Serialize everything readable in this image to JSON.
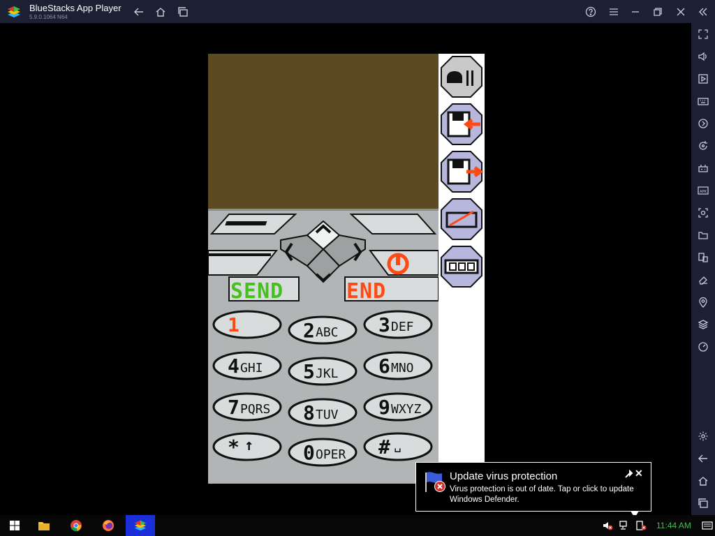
{
  "app": {
    "title": "BlueStacks App Player",
    "version": "5.9.0.1064 N64"
  },
  "phone": {
    "send_label": "SEND",
    "end_label": "END",
    "keys": [
      {
        "main": "1",
        "sub": ""
      },
      {
        "main": "2",
        "sub": "ABC"
      },
      {
        "main": "3",
        "sub": "DEF"
      },
      {
        "main": "4",
        "sub": "GHI"
      },
      {
        "main": "5",
        "sub": "JKL"
      },
      {
        "main": "6",
        "sub": "MNO"
      },
      {
        "main": "7",
        "sub": "PQRS"
      },
      {
        "main": "8",
        "sub": "TUV"
      },
      {
        "main": "9",
        "sub": "WXYZ"
      },
      {
        "main": "*",
        "sub": "↑"
      },
      {
        "main": "0",
        "sub": "OPER"
      },
      {
        "main": "#",
        "sub": "␣"
      }
    ],
    "screen_color": "#5e4a22"
  },
  "taskbar": {
    "clock": "11:44 AM"
  },
  "notification": {
    "title": "Update virus protection",
    "body": "Virus protection is out of date. Tap or click to update Windows Defender."
  },
  "colors": {
    "accent_blue": "#1a2fd8",
    "titlebar": "#1c2033",
    "send": "#45c01e",
    "end": "#ff4a14",
    "clock": "#40c050"
  }
}
